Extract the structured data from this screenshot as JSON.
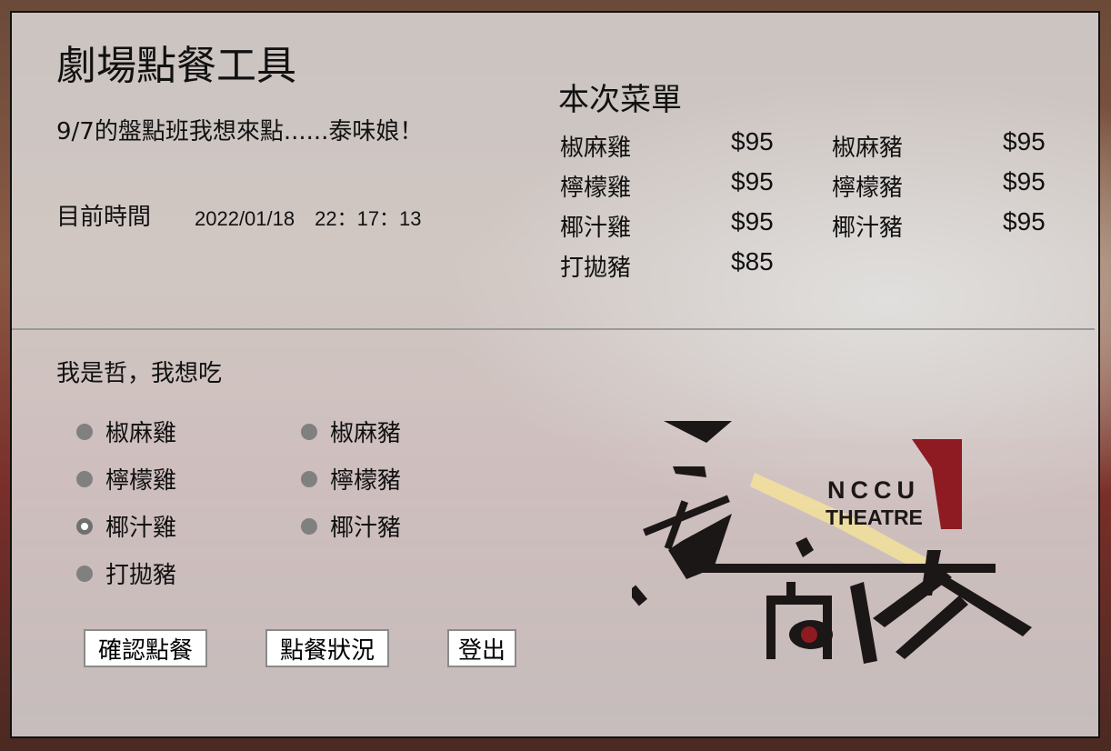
{
  "header": {
    "title": "劇場點餐工具",
    "subtitle": "9/7的盤點班我想來點......泰味娘！",
    "time_label": "目前時間",
    "time_value": "2022/01/18　22：17：13"
  },
  "menu": {
    "title": "本次菜單",
    "items": [
      {
        "name": "椒麻雞",
        "price": "$95"
      },
      {
        "name": "檸檬雞",
        "price": "$95"
      },
      {
        "name": "椰汁雞",
        "price": "$95"
      },
      {
        "name": "打拋豬",
        "price": "$85"
      },
      {
        "name": "椒麻豬",
        "price": "$95"
      },
      {
        "name": "檸檬豬",
        "price": "$95"
      },
      {
        "name": "椰汁豬",
        "price": "$95"
      }
    ]
  },
  "order": {
    "prompt": "我是哲，我想吃",
    "options": [
      "椒麻雞",
      "檸檬雞",
      "椰汁雞",
      "打拋豬",
      "椒麻豬",
      "檸檬豬",
      "椰汁豬"
    ],
    "selected": "椰汁雞"
  },
  "buttons": {
    "confirm": "確認點餐",
    "status": "點餐狀況",
    "logout": "登出"
  },
  "logo": {
    "text_line1": "NCCU",
    "text_line2": "THEATRE",
    "accent_color": "#8e1b22",
    "light_color": "#f1df9c"
  }
}
